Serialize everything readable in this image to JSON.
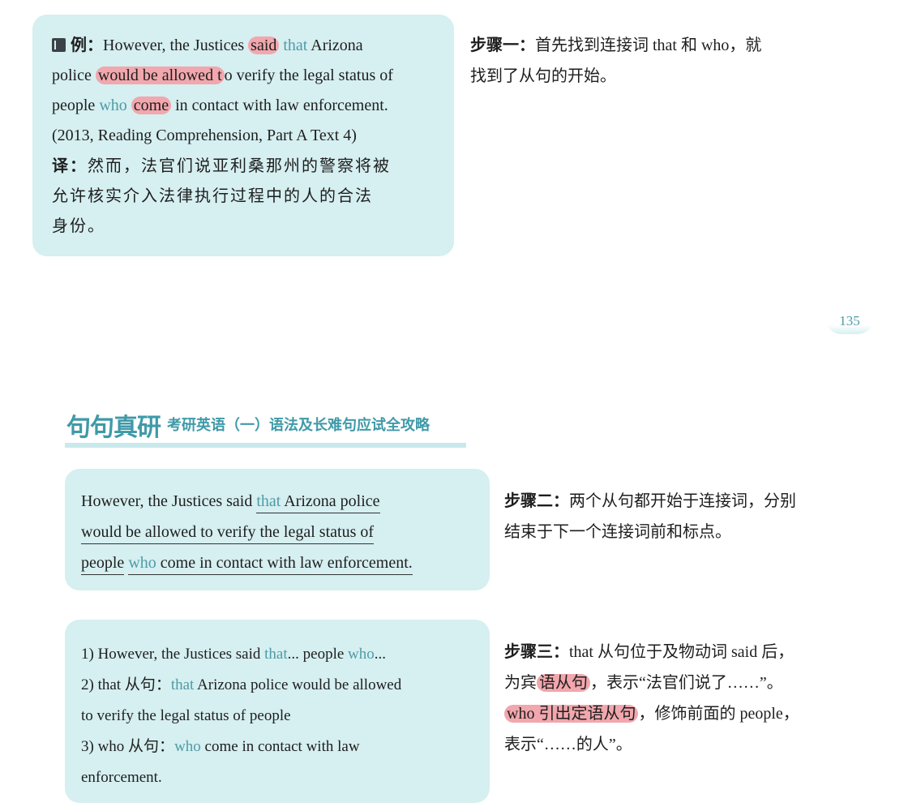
{
  "example": {
    "label": "例：",
    "l1_pre": "However, the Justices ",
    "l1_said": "said",
    "l1_that": " that",
    "l1_post": " Arizona",
    "l2_pre": "police ",
    "l2_hl": "would be allowed t",
    "l2_post": "o verify the legal status of",
    "l3_pre": "people ",
    "l3_who": "who",
    "l3_come": "come",
    "l3_post": " in contact with law enforcement.",
    "l4": "(2013, Reading Comprehension, Part A Text 4)",
    "trans_label": "译：",
    "trans_l1": "然而，法官们说亚利桑那州的警察将被",
    "trans_l2": "允许核实介入法律执行过程中的人的合法",
    "trans_l3": "身份。"
  },
  "step1": {
    "label": "步骤一：",
    "l1": "首先找到连接词 that 和 who，就",
    "l2": "找到了从句的开始。"
  },
  "page_number": "135",
  "header": {
    "logo": "句句真研",
    "subtitle": "考研英语（一）语法及长难句应试全攻略"
  },
  "split": {
    "l1_pre": "However, the Justices said ",
    "l1_that": "that",
    "l1_post": " Arizona police",
    "l2": "would be allowed to verify the legal status of",
    "l3_pre": "people",
    "l3_who": "who",
    "l3_post": " come in contact with law enforcement."
  },
  "step2": {
    "label": "步骤二：",
    "l1": "两个从句都开始于连接词，分别",
    "l2": "结束于下一个连接词前和标点。"
  },
  "numbered": {
    "i1_pre": "1) However, the Justices said ",
    "i1_that": "that",
    "i1_mid": "... people ",
    "i1_who": "who",
    "i1_post": "...",
    "i2_pre": "2) that 从句：",
    "i2_that": "that",
    "i2_post": " Arizona police would be allowed",
    "i2_l2": "to verify the legal status of people",
    "i3_pre": "3) who 从句：",
    "i3_who": "who",
    "i3_post": " come in contact with law",
    "i3_l2": "enforcement."
  },
  "step3": {
    "label": "步骤三：",
    "l1": "that 从句位于及物动词 said 后，",
    "l2_pre": "为宾",
    "l2_hl": "语从句",
    "l2_post": "，表示“法官们说了……”。",
    "l3_hl": "who 引出定语从句",
    "l3_post": "，修饰前面的 people，",
    "l4": "表示“……的人”。"
  },
  "colors": {
    "panel": "#d6eff1",
    "accent": "#4e9ba6",
    "highlight": "#f1a7ad"
  }
}
